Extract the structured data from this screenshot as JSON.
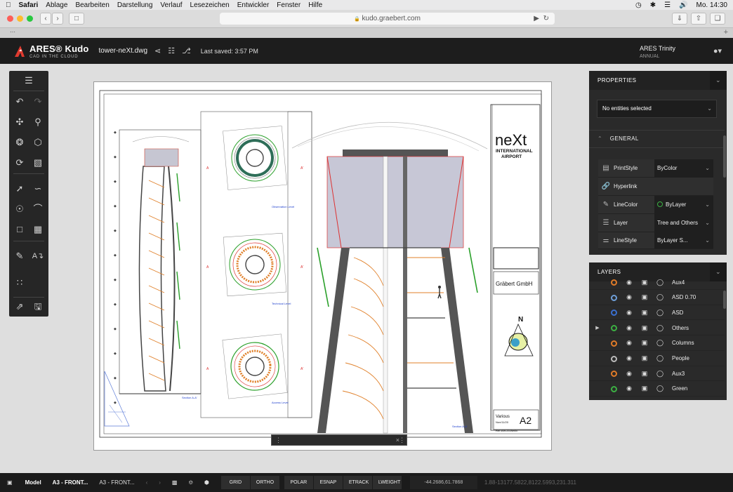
{
  "menubar": {
    "apple": "",
    "app": "Safari",
    "items": [
      "Ablage",
      "Bearbeiten",
      "Darstellung",
      "Verlauf",
      "Lesezeichen",
      "Entwickler",
      "Fenster",
      "Hilfe"
    ],
    "clock": "Mo. 14:30"
  },
  "safari": {
    "url": "kudo.graebert.com",
    "lock": "🔒"
  },
  "app": {
    "brand": "ARES® Kudo",
    "brand_sub": "CAD IN THE CLOUD",
    "filename": "tower-neXt.dwg",
    "last_saved": "Last saved: 3:57 PM",
    "account_name": "ARES Trinity",
    "account_plan": "ANNUAL"
  },
  "drawing": {
    "title_big": "neXt",
    "title_sub1": "INTERNATIONAL",
    "title_sub2": "AIRPORT",
    "company": "Gräbert GmbH",
    "north": "N",
    "various": "Various",
    "date": "Nov/11/20",
    "sheet": "A2",
    "ref": "Ref #69-20-Berlin"
  },
  "properties": {
    "header": "PROPERTIES",
    "selection": "No entities selected",
    "general": "GENERAL",
    "rows": [
      {
        "name": "PrintStyle",
        "value": "ByColor",
        "icon": "printstyle-icon"
      },
      {
        "name": "Hyperlink",
        "value": "",
        "icon": "link-icon"
      },
      {
        "name": "LineColor",
        "value": "ByLayer",
        "icon": "linecolor-icon"
      },
      {
        "name": "Layer",
        "value": "Tree and Others",
        "icon": "layers-icon"
      },
      {
        "name": "LineStyle",
        "value": "ByLayer S...",
        "icon": "linestyle-icon"
      }
    ]
  },
  "layers": {
    "header": "LAYERS",
    "rows": [
      {
        "name": "Aux4",
        "color": "#e07b28"
      },
      {
        "name": "ASD 0.70",
        "color": "#6f9fd8"
      },
      {
        "name": "ASD",
        "color": "#3a6fd0"
      },
      {
        "name": "Others",
        "color": "#3cb043",
        "current": true
      },
      {
        "name": "Columns",
        "color": "#e07b28"
      },
      {
        "name": "People",
        "color": "#bbbbbb"
      },
      {
        "name": "Aux3",
        "color": "#e07b28"
      },
      {
        "name": "Green",
        "color": "#3cb043"
      }
    ]
  },
  "statusbar": {
    "tabs": [
      "Model",
      "A3 - FRONT...",
      "A3 - FRONT..."
    ],
    "toggles": [
      "GRID",
      "ORTHO",
      "POLAR",
      "ESNAP",
      "ETRACK",
      "LWEIGHT"
    ],
    "coords": "-44.2686,61.7868",
    "coords2": "1.88-13177.5822,8122.5993,231.311"
  }
}
